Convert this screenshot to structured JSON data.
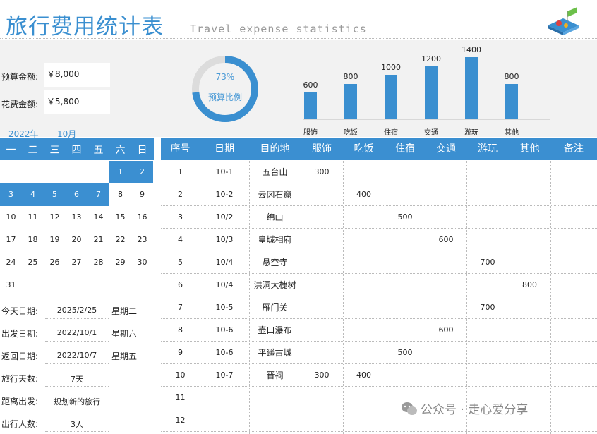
{
  "header": {
    "title": "旅行费用统计表",
    "subtitle": "Travel expense statistics"
  },
  "budget": {
    "budget_label": "预算金额:",
    "budget_value": "￥8,000",
    "spent_label": "花费金额:",
    "spent_value": "￥5,800"
  },
  "ring": {
    "percent_text": "73%",
    "percent_value": 0.73,
    "label": "预算比例"
  },
  "chart_data": {
    "type": "bar",
    "categories": [
      "服饰",
      "吃饭",
      "住宿",
      "交通",
      "游玩",
      "其他"
    ],
    "values": [
      600,
      800,
      1000,
      1200,
      1400,
      800
    ],
    "value_labels": [
      "600",
      "800",
      "1000",
      "1200",
      "1400",
      "800"
    ],
    "ylim": [
      0,
      1400
    ],
    "color": "#3a8fd0"
  },
  "calendar": {
    "year_label": "2022年",
    "month_label": "10月",
    "weekdays": [
      "一",
      "二",
      "三",
      "四",
      "五",
      "六",
      "日"
    ],
    "rows": [
      [
        "",
        "",
        "",
        "",
        "",
        "1",
        "2"
      ],
      [
        "3",
        "4",
        "5",
        "6",
        "7",
        "8",
        "9"
      ],
      [
        "10",
        "11",
        "12",
        "13",
        "14",
        "15",
        "16"
      ],
      [
        "17",
        "18",
        "19",
        "20",
        "21",
        "22",
        "23"
      ],
      [
        "24",
        "25",
        "26",
        "27",
        "28",
        "29",
        "30"
      ],
      [
        "31",
        "",
        "",
        "",
        "",
        "",
        ""
      ]
    ],
    "highlighted": [
      "1",
      "2",
      "3",
      "4",
      "5",
      "6",
      "7"
    ]
  },
  "info": [
    {
      "label": "今天日期:",
      "value": "2025/2/25",
      "extra": "星期二"
    },
    {
      "label": "出发日期:",
      "value": "2022/10/1",
      "extra": "星期六"
    },
    {
      "label": "返回日期:",
      "value": "2022/10/7",
      "extra": "星期五"
    },
    {
      "label": "旅行天数:",
      "value": "7天",
      "extra": ""
    },
    {
      "label": "距离出发:",
      "value": "规划新的旅行",
      "extra": ""
    },
    {
      "label": "出行人数:",
      "value": "3人",
      "extra": ""
    }
  ],
  "table": {
    "columns": [
      "序号",
      "日期",
      "目的地",
      "服饰",
      "吃饭",
      "住宿",
      "交通",
      "游玩",
      "其他",
      "备注"
    ],
    "rows": [
      [
        "1",
        "10-1",
        "五台山",
        "300",
        "",
        "",
        "",
        "",
        "",
        ""
      ],
      [
        "2",
        "10-2",
        "云冈石窟",
        "",
        "400",
        "",
        "",
        "",
        "",
        ""
      ],
      [
        "3",
        "10/2",
        "绵山",
        "",
        "",
        "500",
        "",
        "",
        "",
        ""
      ],
      [
        "4",
        "10/3",
        "皇城相府",
        "",
        "",
        "",
        "600",
        "",
        "",
        ""
      ],
      [
        "5",
        "10/4",
        "悬空寺",
        "",
        "",
        "",
        "",
        "700",
        "",
        ""
      ],
      [
        "6",
        "10/4",
        "洪洞大槐树",
        "",
        "",
        "",
        "",
        "",
        "800",
        ""
      ],
      [
        "7",
        "10-5",
        "雁门关",
        "",
        "",
        "",
        "",
        "700",
        "",
        ""
      ],
      [
        "8",
        "10-6",
        "壶口瀑布",
        "",
        "",
        "",
        "600",
        "",
        "",
        ""
      ],
      [
        "9",
        "10-6",
        "平遥古城",
        "",
        "",
        "500",
        "",
        "",
        "",
        ""
      ],
      [
        "10",
        "10-7",
        "晋祠",
        "300",
        "400",
        "",
        "",
        "",
        "",
        ""
      ],
      [
        "11",
        "",
        "",
        "",
        "",
        "",
        "",
        "",
        "",
        ""
      ],
      [
        "12",
        "",
        "",
        "",
        "",
        "",
        "",
        "",
        "",
        ""
      ]
    ]
  },
  "watermark": {
    "text": "公众号 · 走心爱分享",
    "icon": "wechat-icon"
  },
  "logo": {
    "icon": "map-pin-logo-icon"
  }
}
